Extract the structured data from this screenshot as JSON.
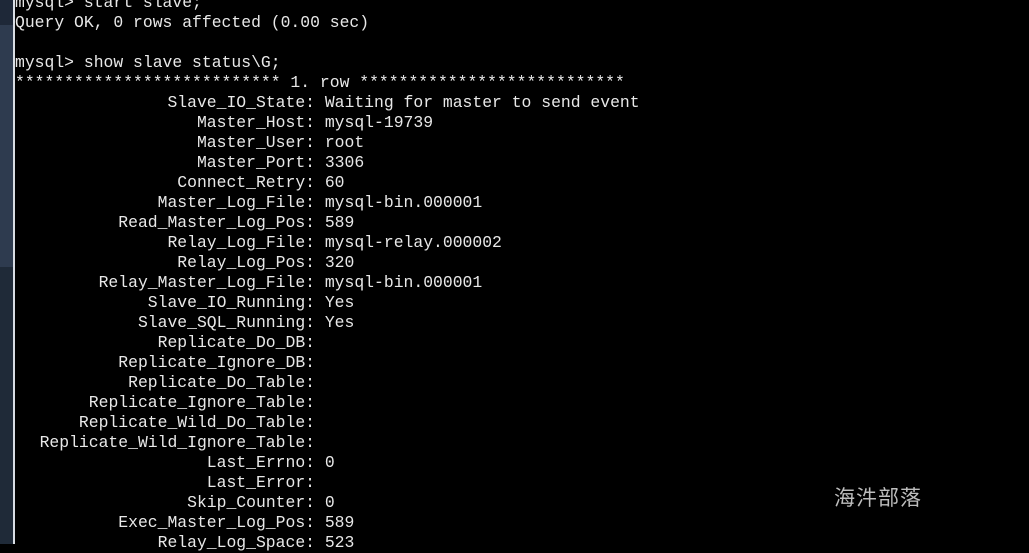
{
  "terminal": {
    "lines": [
      {
        "type": "prompt",
        "prompt": "mysql>",
        "command": "start slave;"
      },
      {
        "type": "output",
        "text": "Query OK, 0 rows affected (0.00 sec)"
      },
      {
        "type": "blank"
      },
      {
        "type": "prompt",
        "prompt": "mysql>",
        "command": "show slave status\\G;"
      },
      {
        "type": "output",
        "text": "*************************** 1. row ***************************"
      }
    ],
    "fields": [
      {
        "name": "Slave_IO_State",
        "value": "Waiting for master to send event"
      },
      {
        "name": "Master_Host",
        "value": "mysql-19739"
      },
      {
        "name": "Master_User",
        "value": "root"
      },
      {
        "name": "Master_Port",
        "value": "3306"
      },
      {
        "name": "Connect_Retry",
        "value": "60"
      },
      {
        "name": "Master_Log_File",
        "value": "mysql-bin.000001"
      },
      {
        "name": "Read_Master_Log_Pos",
        "value": "589"
      },
      {
        "name": "Relay_Log_File",
        "value": "mysql-relay.000002"
      },
      {
        "name": "Relay_Log_Pos",
        "value": "320"
      },
      {
        "name": "Relay_Master_Log_File",
        "value": "mysql-bin.000001"
      },
      {
        "name": "Slave_IO_Running",
        "value": "Yes"
      },
      {
        "name": "Slave_SQL_Running",
        "value": "Yes"
      },
      {
        "name": "Replicate_Do_DB",
        "value": ""
      },
      {
        "name": "Replicate_Ignore_DB",
        "value": ""
      },
      {
        "name": "Replicate_Do_Table",
        "value": ""
      },
      {
        "name": "Replicate_Ignore_Table",
        "value": ""
      },
      {
        "name": "Replicate_Wild_Do_Table",
        "value": ""
      },
      {
        "name": "Replicate_Wild_Ignore_Table",
        "value": ""
      },
      {
        "name": "Last_Errno",
        "value": "0"
      },
      {
        "name": "Last_Error",
        "value": ""
      },
      {
        "name": "Skip_Counter",
        "value": "0"
      },
      {
        "name": "Exec_Master_Log_Pos",
        "value": "589"
      },
      {
        "name": "Relay_Log_Space",
        "value": "523"
      }
    ]
  },
  "watermark": "海汼部落",
  "colors": {
    "background": "#000000",
    "text": "#e8e8e8",
    "sidebar": "#2e3b4f"
  }
}
